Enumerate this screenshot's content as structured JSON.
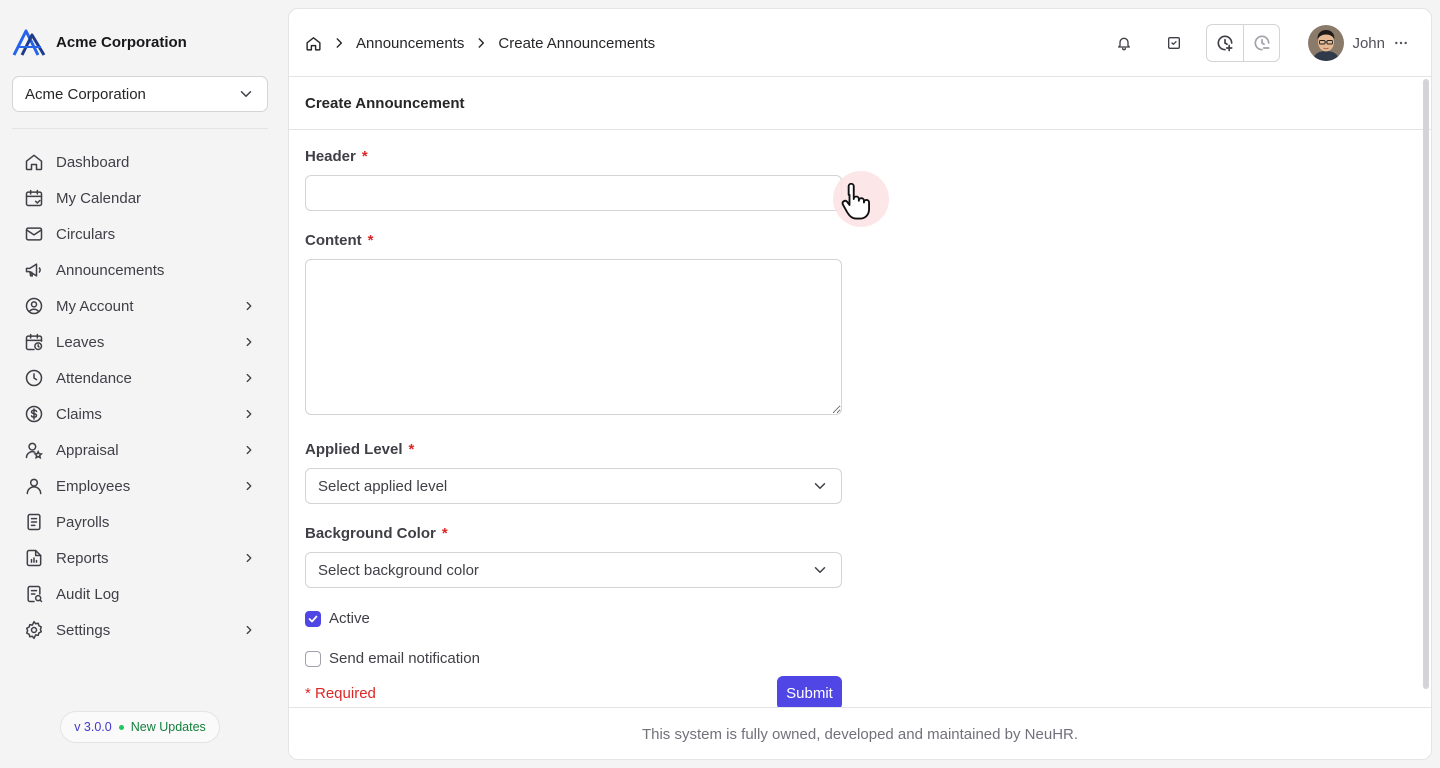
{
  "sidebar": {
    "brand_name": "Acme Corporation",
    "org_select_value": "Acme Corporation",
    "items": [
      {
        "label": "Dashboard",
        "icon": "home-icon",
        "has_children": false
      },
      {
        "label": "My Calendar",
        "icon": "calendar-icon",
        "has_children": false
      },
      {
        "label": "Circulars",
        "icon": "mail-icon",
        "has_children": false
      },
      {
        "label": "Announcements",
        "icon": "megaphone-icon",
        "has_children": false
      },
      {
        "label": "My Account",
        "icon": "user-circle-icon",
        "has_children": true
      },
      {
        "label": "Leaves",
        "icon": "calendar-clock-icon",
        "has_children": true
      },
      {
        "label": "Attendance",
        "icon": "clock-icon",
        "has_children": true
      },
      {
        "label": "Claims",
        "icon": "dollar-circle-icon",
        "has_children": true
      },
      {
        "label": "Appraisal",
        "icon": "user-star-icon",
        "has_children": true
      },
      {
        "label": "Employees",
        "icon": "user-icon",
        "has_children": true
      },
      {
        "label": "Payrolls",
        "icon": "receipt-icon",
        "has_children": false
      },
      {
        "label": "Reports",
        "icon": "report-icon",
        "has_children": true
      },
      {
        "label": "Audit Log",
        "icon": "audit-icon",
        "has_children": false
      },
      {
        "label": "Settings",
        "icon": "gear-icon",
        "has_children": true
      }
    ],
    "version": "v 3.0.0",
    "updates_label": "New Updates"
  },
  "topbar": {
    "breadcrumbs": [
      "Announcements",
      "Create Announcements"
    ],
    "user_name": "John"
  },
  "form": {
    "title": "Create Announcement",
    "header_label": "Header",
    "header_value": "",
    "content_label": "Content",
    "content_value": "",
    "applied_level_label": "Applied Level",
    "applied_level_value": "Select applied level",
    "background_color_label": "Background Color",
    "background_color_value": "Select background color",
    "active_label": "Active",
    "active_checked": true,
    "email_label": "Send email notification",
    "email_checked": false,
    "required_mark": "*",
    "required_note": "* Required",
    "submit_label": "Submit"
  },
  "footer": {
    "text": "This system is fully owned, developed and maintained by NeuHR."
  },
  "colors": {
    "accent": "#4f46e5",
    "required": "#dc2626",
    "brand_logo": "#2563eb"
  }
}
